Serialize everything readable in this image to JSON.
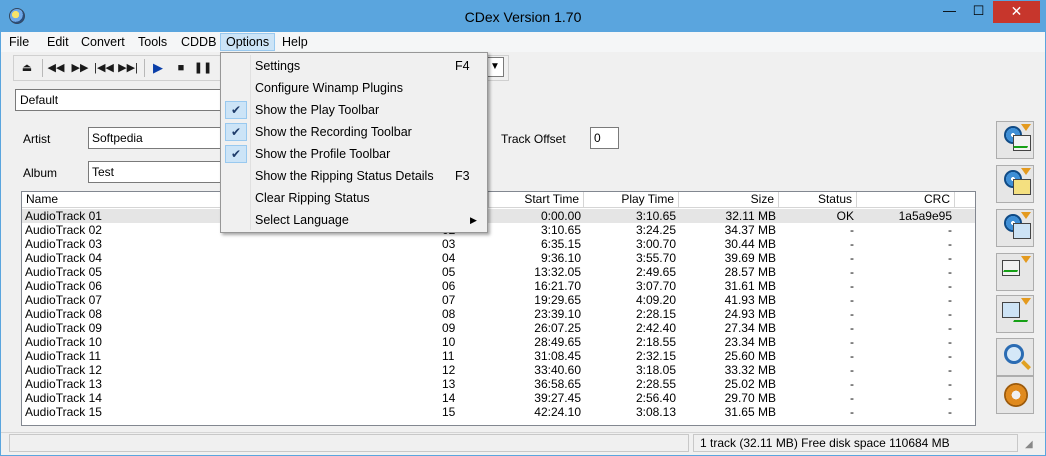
{
  "window": {
    "title": "CDex Version 1.70"
  },
  "title_buttons": {
    "minimize": "—",
    "maximize": "☐",
    "close": "✕"
  },
  "menu": [
    "File",
    "Edit",
    "Convert",
    "Tools",
    "CDDB",
    "Options",
    "Help"
  ],
  "profile": "Default",
  "fields": {
    "artist_label": "Artist",
    "artist_value": "Softpedia",
    "album_label": "Album",
    "album_value": "Test",
    "track_offset_label": "Track Offset",
    "track_offset_value": "0"
  },
  "columns": [
    "Name",
    "Start Time",
    "Play Time",
    "Size",
    "Status",
    "CRC"
  ],
  "tracks": [
    {
      "name": "AudioTrack 01",
      "num": "01",
      "start": "0:00.00",
      "play": "3:10.65",
      "size": "32.11 MB",
      "status": "OK",
      "crc": "1a5a9e95"
    },
    {
      "name": "AudioTrack 02",
      "num": "02",
      "start": "3:10.65",
      "play": "3:24.25",
      "size": "34.37 MB",
      "status": "-",
      "crc": "-"
    },
    {
      "name": "AudioTrack 03",
      "num": "03",
      "start": "6:35.15",
      "play": "3:00.70",
      "size": "30.44 MB",
      "status": "-",
      "crc": "-"
    },
    {
      "name": "AudioTrack 04",
      "num": "04",
      "start": "9:36.10",
      "play": "3:55.70",
      "size": "39.69 MB",
      "status": "-",
      "crc": "-"
    },
    {
      "name": "AudioTrack 05",
      "num": "05",
      "start": "13:32.05",
      "play": "2:49.65",
      "size": "28.57 MB",
      "status": "-",
      "crc": "-"
    },
    {
      "name": "AudioTrack 06",
      "num": "06",
      "start": "16:21.70",
      "play": "3:07.70",
      "size": "31.61 MB",
      "status": "-",
      "crc": "-"
    },
    {
      "name": "AudioTrack 07",
      "num": "07",
      "start": "19:29.65",
      "play": "4:09.20",
      "size": "41.93 MB",
      "status": "-",
      "crc": "-"
    },
    {
      "name": "AudioTrack 08",
      "num": "08",
      "start": "23:39.10",
      "play": "2:28.15",
      "size": "24.93 MB",
      "status": "-",
      "crc": "-"
    },
    {
      "name": "AudioTrack 09",
      "num": "09",
      "start": "26:07.25",
      "play": "2:42.40",
      "size": "27.34 MB",
      "status": "-",
      "crc": "-"
    },
    {
      "name": "AudioTrack 10",
      "num": "10",
      "start": "28:49.65",
      "play": "2:18.55",
      "size": "23.34 MB",
      "status": "-",
      "crc": "-"
    },
    {
      "name": "AudioTrack 11",
      "num": "11",
      "start": "31:08.45",
      "play": "2:32.15",
      "size": "25.60 MB",
      "status": "-",
      "crc": "-"
    },
    {
      "name": "AudioTrack 12",
      "num": "12",
      "start": "33:40.60",
      "play": "3:18.05",
      "size": "33.32 MB",
      "status": "-",
      "crc": "-"
    },
    {
      "name": "AudioTrack 13",
      "num": "13",
      "start": "36:58.65",
      "play": "2:28.55",
      "size": "25.02 MB",
      "status": "-",
      "crc": "-"
    },
    {
      "name": "AudioTrack 14",
      "num": "14",
      "start": "39:27.45",
      "play": "2:56.40",
      "size": "29.70 MB",
      "status": "-",
      "crc": "-"
    },
    {
      "name": "AudioTrack 15",
      "num": "15",
      "start": "42:24.10",
      "play": "3:08.13",
      "size": "31.65 MB",
      "status": "-",
      "crc": "-"
    }
  ],
  "options_menu": [
    {
      "label": "Settings",
      "key": "F4",
      "checked": false,
      "submenu": false
    },
    {
      "label": "Configure Winamp Plugins",
      "key": "",
      "checked": false,
      "submenu": false
    },
    {
      "label": "Show the Play Toolbar",
      "key": "",
      "checked": true,
      "submenu": false
    },
    {
      "label": "Show the Recording Toolbar",
      "key": "",
      "checked": true,
      "submenu": false
    },
    {
      "label": "Show the Profile Toolbar",
      "key": "",
      "checked": true,
      "submenu": false
    },
    {
      "label": "Show the Ripping Status Details",
      "key": "F3",
      "checked": false,
      "submenu": false
    },
    {
      "label": "Clear Ripping Status",
      "key": "",
      "checked": false,
      "submenu": false
    },
    {
      "label": "Select Language",
      "key": "",
      "checked": false,
      "submenu": true
    }
  ],
  "toolbar_icons": [
    "eject-icon",
    "rewind-icon",
    "fast-forward-icon",
    "previous-track-icon",
    "next-track-icon",
    "play-icon",
    "stop-icon",
    "pause-icon"
  ],
  "status_text": "1 track (32.11 MB) Free disk space 110684 MB",
  "side_buttons": [
    "extract-to-wav-icon",
    "extract-to-compressed-icon",
    "extract-partial-icon",
    "convert-wav-icon",
    "convert-compressed-icon",
    "cddb-lookup-icon",
    "settings-gear-icon"
  ]
}
